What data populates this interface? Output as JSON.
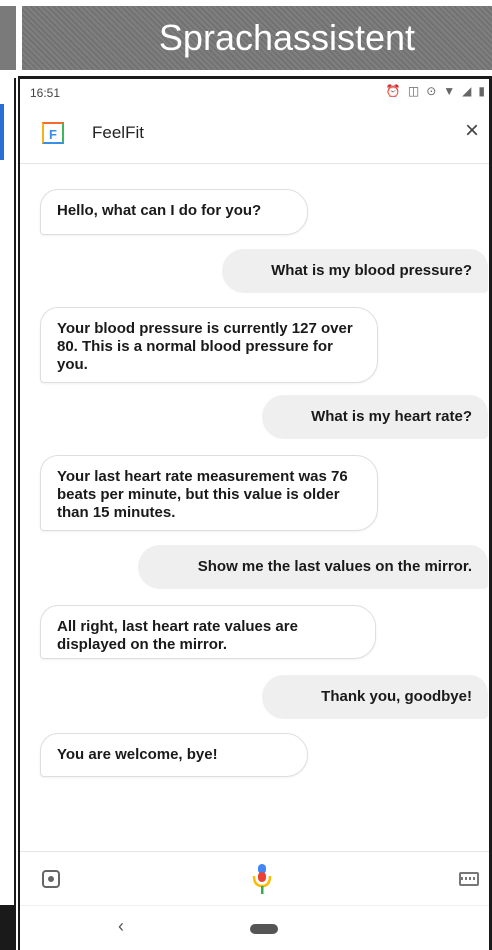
{
  "banner": {
    "title": "Sprachassistent"
  },
  "status": {
    "time": "16:51"
  },
  "app": {
    "name": "FeelFit",
    "logo_letter": "F",
    "close_symbol": "×"
  },
  "messages": [
    {
      "role": "bot",
      "text": "Hello, what can I do for you?"
    },
    {
      "role": "user",
      "text": "What is my blood pressure?"
    },
    {
      "role": "bot",
      "text": "Your blood pressure is currently 127 over 80. This is a normal blood pressure for you."
    },
    {
      "role": "user",
      "text": "What is my heart rate?"
    },
    {
      "role": "bot",
      "text": "Your last heart rate measurement was 76 beats per minute, but this value is older than 15 minutes."
    },
    {
      "role": "user",
      "text": "Show me the last values on the mirror."
    },
    {
      "role": "bot",
      "text": "All right, last heart rate values are displayed on the mirror."
    },
    {
      "role": "user",
      "text": "Thank you, goodbye!"
    },
    {
      "role": "bot",
      "text": "You are welcome, bye!"
    }
  ],
  "nav": {
    "back_symbol": "‹"
  },
  "colors": {
    "banner": "#777777",
    "mic_blue": "#4285f4",
    "mic_red": "#ea4335",
    "mic_yellow": "#fbbc05",
    "mic_green": "#34a853"
  }
}
